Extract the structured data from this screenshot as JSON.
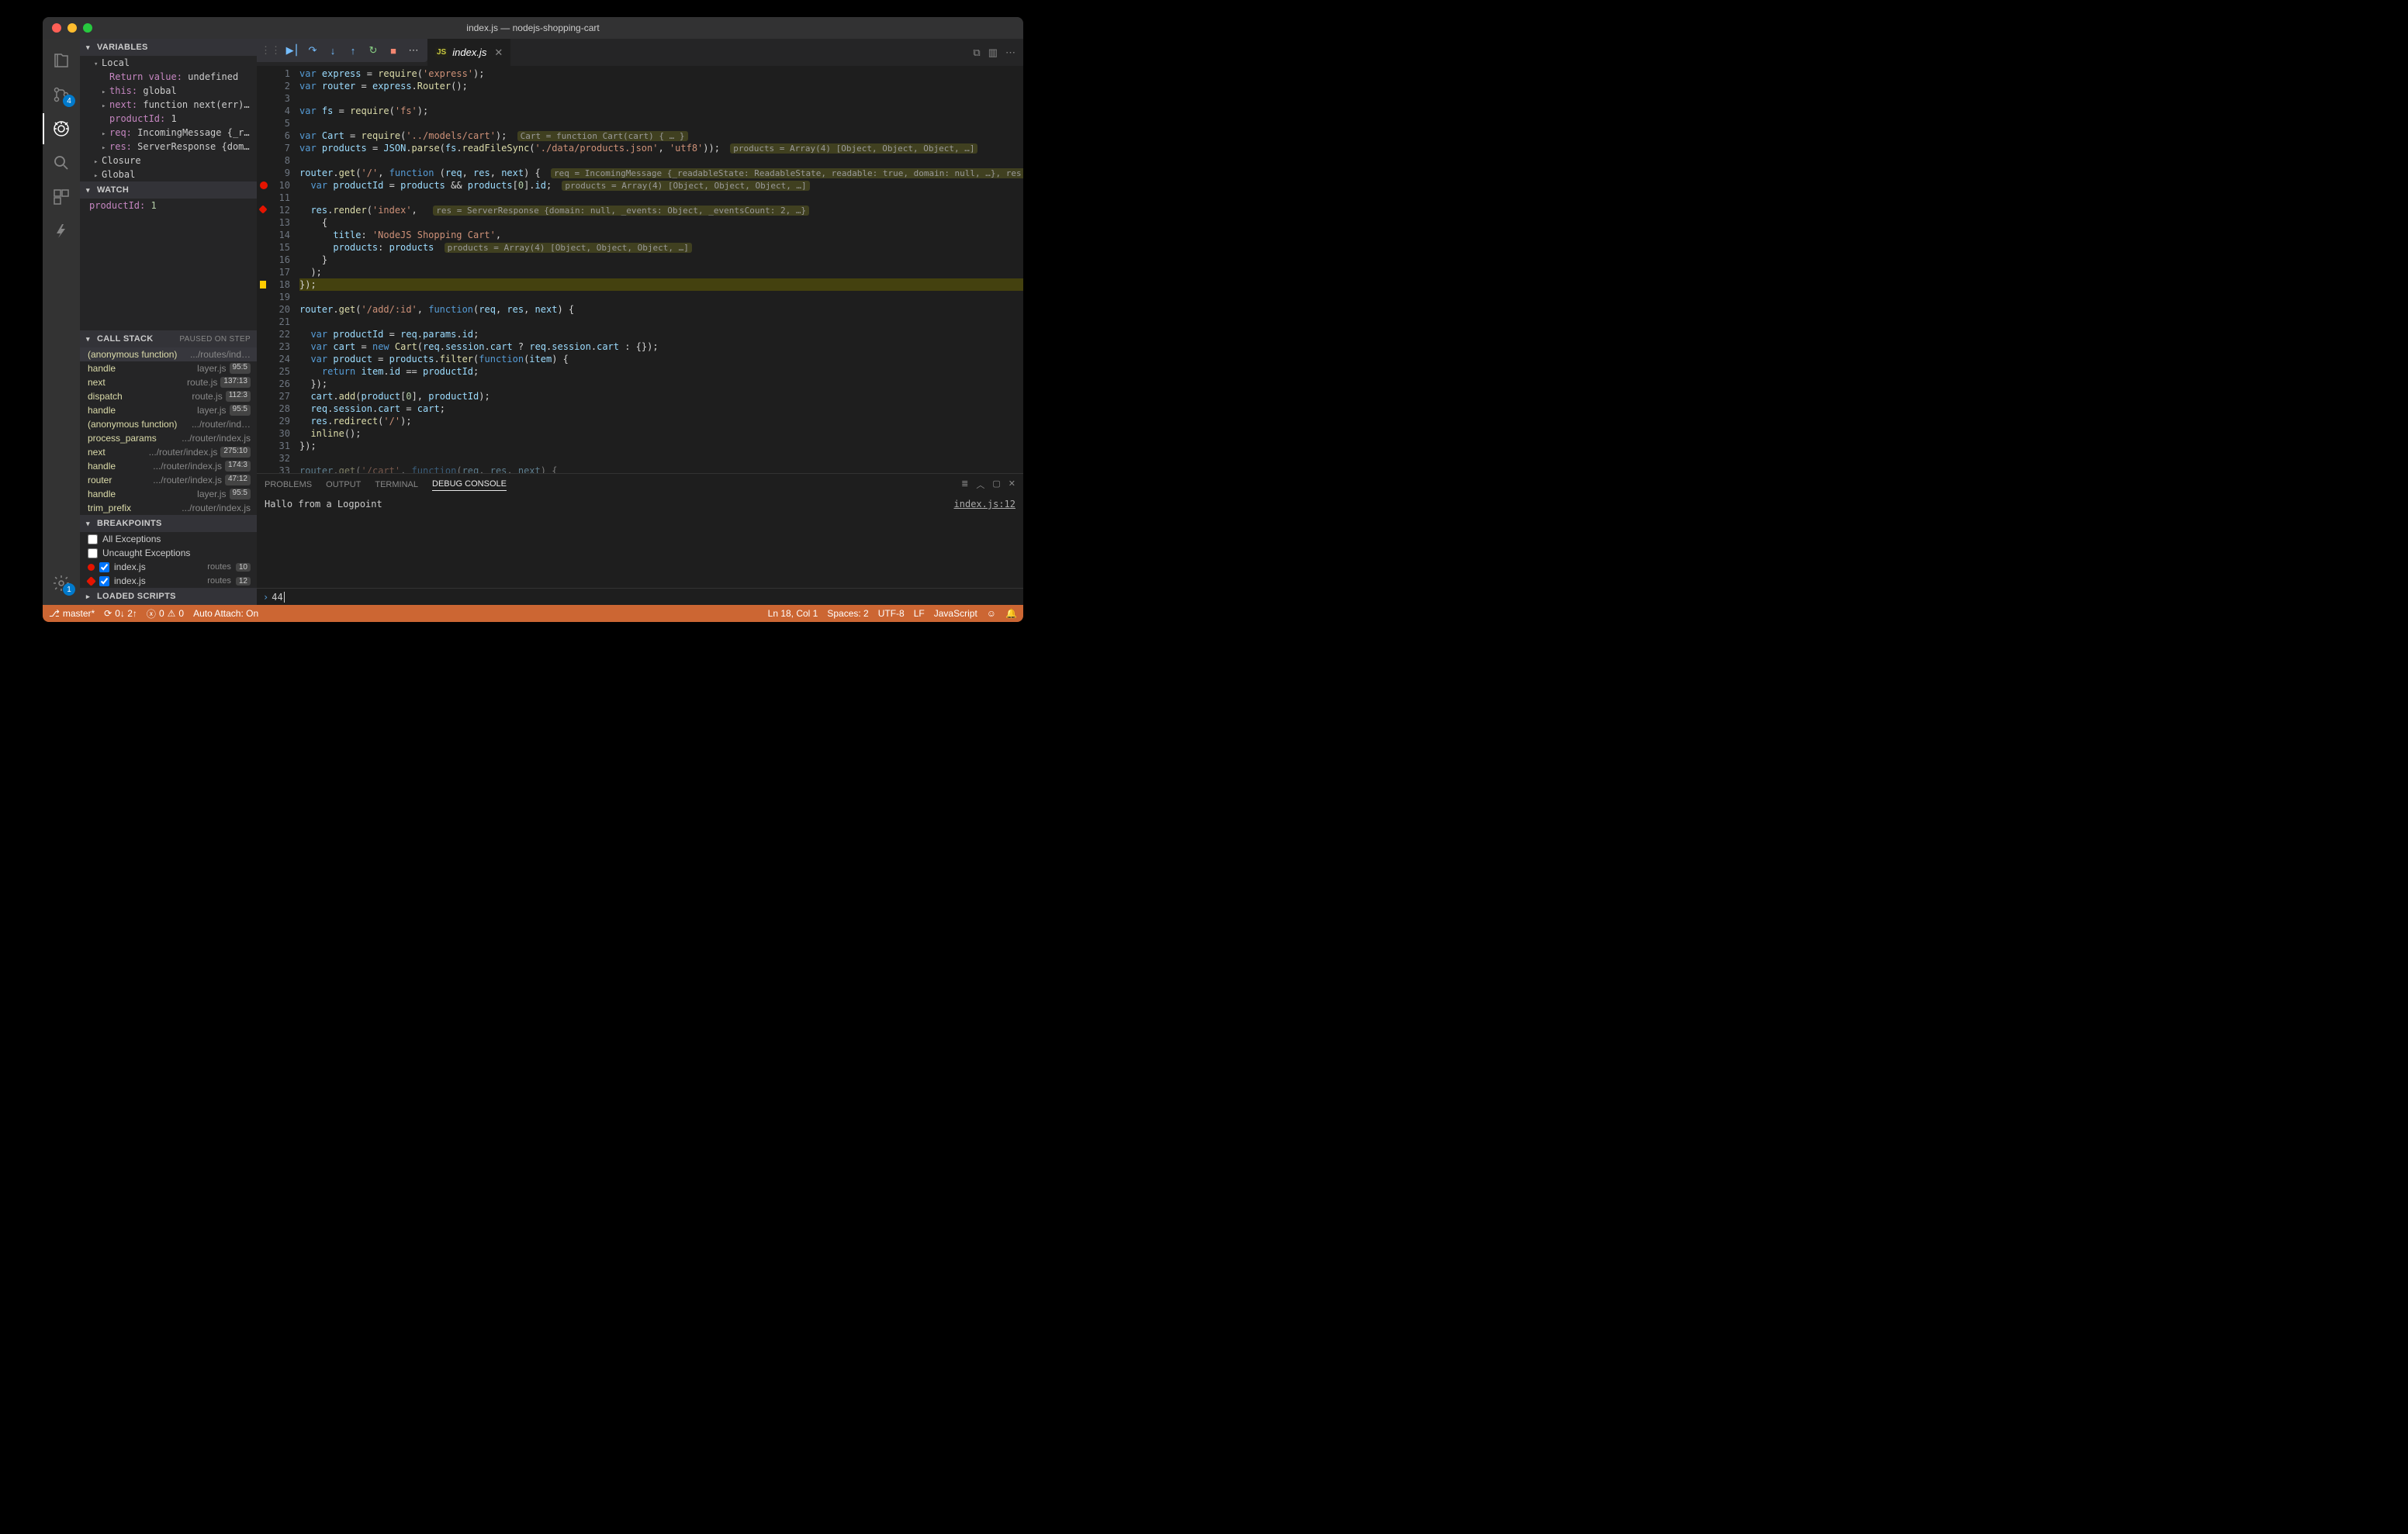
{
  "window_title": "index.js — nodejs-shopping-cart",
  "activity_bar": {
    "badges": {
      "scm": "4",
      "settings": "1"
    }
  },
  "debug_sidebar": {
    "variables": {
      "title": "VARIABLES",
      "local_title": "Local",
      "rows": [
        {
          "k": "Return value:",
          "v": "undefined",
          "arrow": ""
        },
        {
          "k": "this:",
          "v": "global",
          "arrow": "▸"
        },
        {
          "k": "next:",
          "v": "function next(err) { … }",
          "arrow": "▸"
        },
        {
          "k": "productId:",
          "v": "1",
          "arrow": ""
        },
        {
          "k": "req:",
          "v": "IncomingMessage {_readableSt…",
          "arrow": "▸"
        },
        {
          "k": "res:",
          "v": "ServerResponse {domain: null…",
          "arrow": "▸"
        }
      ],
      "closure_title": "Closure",
      "global_title": "Global"
    },
    "watch": {
      "title": "WATCH",
      "rows": [
        {
          "k": "productId:",
          "v": "1"
        }
      ]
    },
    "callstack": {
      "title": "CALL STACK",
      "extra": "PAUSED ON STEP",
      "rows": [
        {
          "fn": "(anonymous function)",
          "file": ".../routes/ind…",
          "loc": "",
          "sel": true
        },
        {
          "fn": "handle",
          "file": "layer.js",
          "loc": "95:5"
        },
        {
          "fn": "next",
          "file": "route.js",
          "loc": "137:13"
        },
        {
          "fn": "dispatch",
          "file": "route.js",
          "loc": "112:3"
        },
        {
          "fn": "handle",
          "file": "layer.js",
          "loc": "95:5"
        },
        {
          "fn": "(anonymous function)",
          "file": ".../router/ind…",
          "loc": ""
        },
        {
          "fn": "process_params",
          "file": ".../router/index.js",
          "loc": ""
        },
        {
          "fn": "next",
          "file": ".../router/index.js",
          "loc": "275:10"
        },
        {
          "fn": "handle",
          "file": ".../router/index.js",
          "loc": "174:3"
        },
        {
          "fn": "router",
          "file": ".../router/index.js",
          "loc": "47:12"
        },
        {
          "fn": "handle",
          "file": "layer.js",
          "loc": "95:5"
        },
        {
          "fn": "trim_prefix",
          "file": ".../router/index.js",
          "loc": ""
        }
      ]
    },
    "breakpoints": {
      "title": "BREAKPOINTS",
      "all_exc": "All Exceptions",
      "uncaught": "Uncaught Exceptions",
      "rows": [
        {
          "file": "index.js",
          "folder": "routes",
          "line": "10",
          "logpoint": false
        },
        {
          "file": "index.js",
          "folder": "routes",
          "line": "12",
          "logpoint": true
        }
      ]
    },
    "loaded_scripts": {
      "title": "LOADED SCRIPTS"
    }
  },
  "tabs": {
    "current": "index.js"
  },
  "code_lines": [
    {
      "n": 1,
      "html": "<span class='kw'>var</span> <span class='va'>express</span> = <span class='fn'>require</span>(<span class='st'>'express'</span>);"
    },
    {
      "n": 2,
      "html": "<span class='kw'>var</span> <span class='va'>router</span> = <span class='va'>express</span>.<span class='fn'>Router</span>();"
    },
    {
      "n": 3,
      "html": ""
    },
    {
      "n": 4,
      "html": "<span class='kw'>var</span> <span class='va'>fs</span> = <span class='fn'>require</span>(<span class='st'>'fs'</span>);"
    },
    {
      "n": 5,
      "html": ""
    },
    {
      "n": 6,
      "html": "<span class='kw'>var</span> <span class='va'>Cart</span> = <span class='fn'>require</span>(<span class='st'>'../models/cart'</span>); <span class='inl'>Cart = function Cart(cart) { … }</span>"
    },
    {
      "n": 7,
      "html": "<span class='kw'>var</span> <span class='va'>products</span> = <span class='va'>JSON</span>.<span class='fn'>parse</span>(<span class='va'>fs</span>.<span class='fn'>readFileSync</span>(<span class='st'>'./data/products.json'</span>, <span class='st'>'utf8'</span>)); <span class='inl'>products = Array(4) [Object, Object, Object, …]</span>"
    },
    {
      "n": 8,
      "html": ""
    },
    {
      "n": 9,
      "html": "<span class='va'>router</span>.<span class='fn'>get</span>(<span class='st'>'/'</span>, <span class='kw'>function</span> (<span class='va'>req</span>, <span class='va'>res</span>, <span class='va'>next</span>) { <span class='inl'>req = IncomingMessage {_readableState: ReadableState, readable: true, domain: null, …}, res = ServerRes…</span>"
    },
    {
      "n": 10,
      "glyph": "bp",
      "html": "  <span class='kw'>var</span> <span class='va'>productId</span> = <span class='va'>products</span> && <span class='va'>products</span>[<span class='nm'>0</span>].<span class='va'>id</span>; <span class='inl'>products = Array(4) [Object, Object, Object, …]</span>"
    },
    {
      "n": 11,
      "html": ""
    },
    {
      "n": 12,
      "glyph": "lp",
      "html": "  <span class='va'>res</span>.<span class='fn'>render</span>(<span class='st'>'index'</span>,  <span class='inl'>res = ServerResponse {domain: null, _events: Object, _eventsCount: 2, …}</span>"
    },
    {
      "n": 13,
      "html": "    {"
    },
    {
      "n": 14,
      "html": "      <span class='va'>title</span>: <span class='st'>'NodeJS Shopping Cart'</span>,"
    },
    {
      "n": 15,
      "html": "      <span class='va'>products</span>: <span class='va'>products</span> <span class='inl'>products = Array(4) [Object, Object, Object, …]</span>"
    },
    {
      "n": 16,
      "html": "    }"
    },
    {
      "n": 17,
      "html": "  );"
    },
    {
      "n": 18,
      "glyph": "cur",
      "hl": true,
      "html": "});"
    },
    {
      "n": 19,
      "html": ""
    },
    {
      "n": 20,
      "html": "<span class='va'>router</span>.<span class='fn'>get</span>(<span class='st'>'/add/:id'</span>, <span class='kw'>function</span>(<span class='va'>req</span>, <span class='va'>res</span>, <span class='va'>next</span>) {"
    },
    {
      "n": 21,
      "html": ""
    },
    {
      "n": 22,
      "html": "  <span class='kw'>var</span> <span class='va'>productId</span> = <span class='va'>req</span>.<span class='va'>params</span>.<span class='va'>id</span>;"
    },
    {
      "n": 23,
      "html": "  <span class='kw'>var</span> <span class='va'>cart</span> = <span class='kw'>new</span> <span class='fn'>Cart</span>(<span class='va'>req</span>.<span class='va'>session</span>.<span class='va'>cart</span> ? <span class='va'>req</span>.<span class='va'>session</span>.<span class='va'>cart</span> : {});"
    },
    {
      "n": 24,
      "html": "  <span class='kw'>var</span> <span class='va'>product</span> = <span class='va'>products</span>.<span class='fn'>filter</span>(<span class='kw'>function</span>(<span class='va'>item</span>) {"
    },
    {
      "n": 25,
      "html": "    <span class='kw'>return</span> <span class='va'>item</span>.<span class='va'>id</span> == <span class='va'>productId</span>;"
    },
    {
      "n": 26,
      "html": "  });"
    },
    {
      "n": 27,
      "html": "  <span class='va'>cart</span>.<span class='fn'>add</span>(<span class='va'>product</span>[<span class='nm'>0</span>], <span class='va'>productId</span>);"
    },
    {
      "n": 28,
      "html": "  <span class='va'>req</span>.<span class='va'>session</span>.<span class='va'>cart</span> = <span class='va'>cart</span>;"
    },
    {
      "n": 29,
      "html": "  <span class='va'>res</span>.<span class='fn'>redirect</span>(<span class='st'>'/'</span>);"
    },
    {
      "n": 30,
      "html": "  <span class='fn'>inline</span>();"
    },
    {
      "n": 31,
      "html": "});"
    },
    {
      "n": 32,
      "html": ""
    },
    {
      "n": 33,
      "dim": true,
      "html": "<span class='va' style='opacity:.5'>router</span><span style='opacity:.5'>.</span><span class='fn' style='opacity:.5'>get</span><span style='opacity:.5'>(</span><span class='st' style='opacity:.5'>'/cart'</span><span style='opacity:.5'>, </span><span class='kw' style='opacity:.5'>function</span><span style='opacity:.5'>(</span><span class='va' style='opacity:.5'>req</span><span style='opacity:.5'>, </span><span class='va' style='opacity:.5'>res</span><span style='opacity:.5'>, </span><span class='va' style='opacity:.5'>next</span><span style='opacity:.5'>) {</span>"
    }
  ],
  "panel": {
    "tabs": [
      "PROBLEMS",
      "OUTPUT",
      "TERMINAL",
      "DEBUG CONSOLE"
    ],
    "active": 3,
    "message": "Hallo from a Logpoint",
    "location": "index.js:12",
    "repl_input": "44"
  },
  "statusbar": {
    "branch": "master*",
    "sync": "0↓ 2↑",
    "errors": "0",
    "warnings": "0",
    "auto_attach": "Auto Attach: On",
    "cursor": "Ln 18, Col 1",
    "spaces": "Spaces: 2",
    "encoding": "UTF-8",
    "eol": "LF",
    "language": "JavaScript"
  }
}
